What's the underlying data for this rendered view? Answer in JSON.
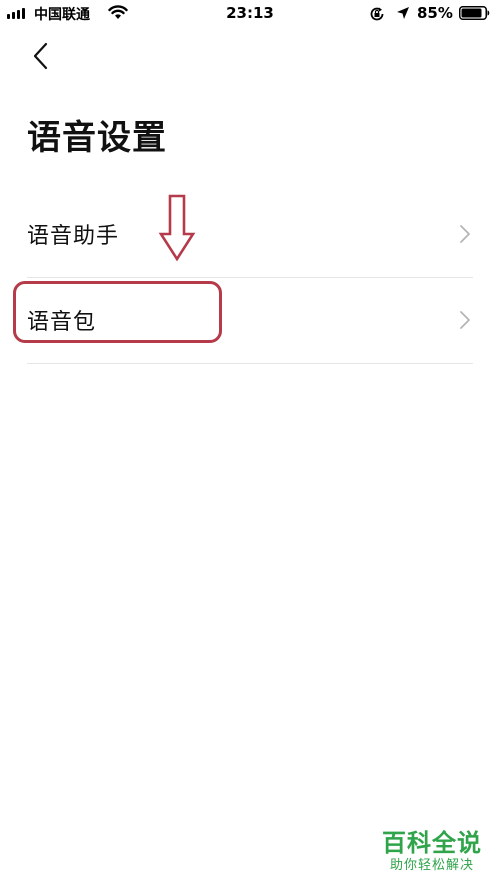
{
  "status_bar": {
    "carrier": "中国联通",
    "time": "23:13",
    "battery_percent": "85%",
    "signal_bars": 4,
    "icons": [
      "signal-icon",
      "wifi-icon",
      "rotation-lock-icon",
      "location-icon",
      "battery-icon"
    ]
  },
  "nav": {
    "back_icon": "chevron-left-icon"
  },
  "page": {
    "title": "语音设置"
  },
  "settings": {
    "items": [
      {
        "label": "语音助手",
        "icon": "chevron-right-icon"
      },
      {
        "label": "语音包",
        "icon": "chevron-right-icon"
      }
    ]
  },
  "annotations": {
    "arrow_icon": "down-arrow-icon",
    "highlight_color": "#b53a4a"
  },
  "watermark": {
    "title": "百科全说",
    "subtitle": "助你轻松解决",
    "color": "#2fa44a"
  }
}
